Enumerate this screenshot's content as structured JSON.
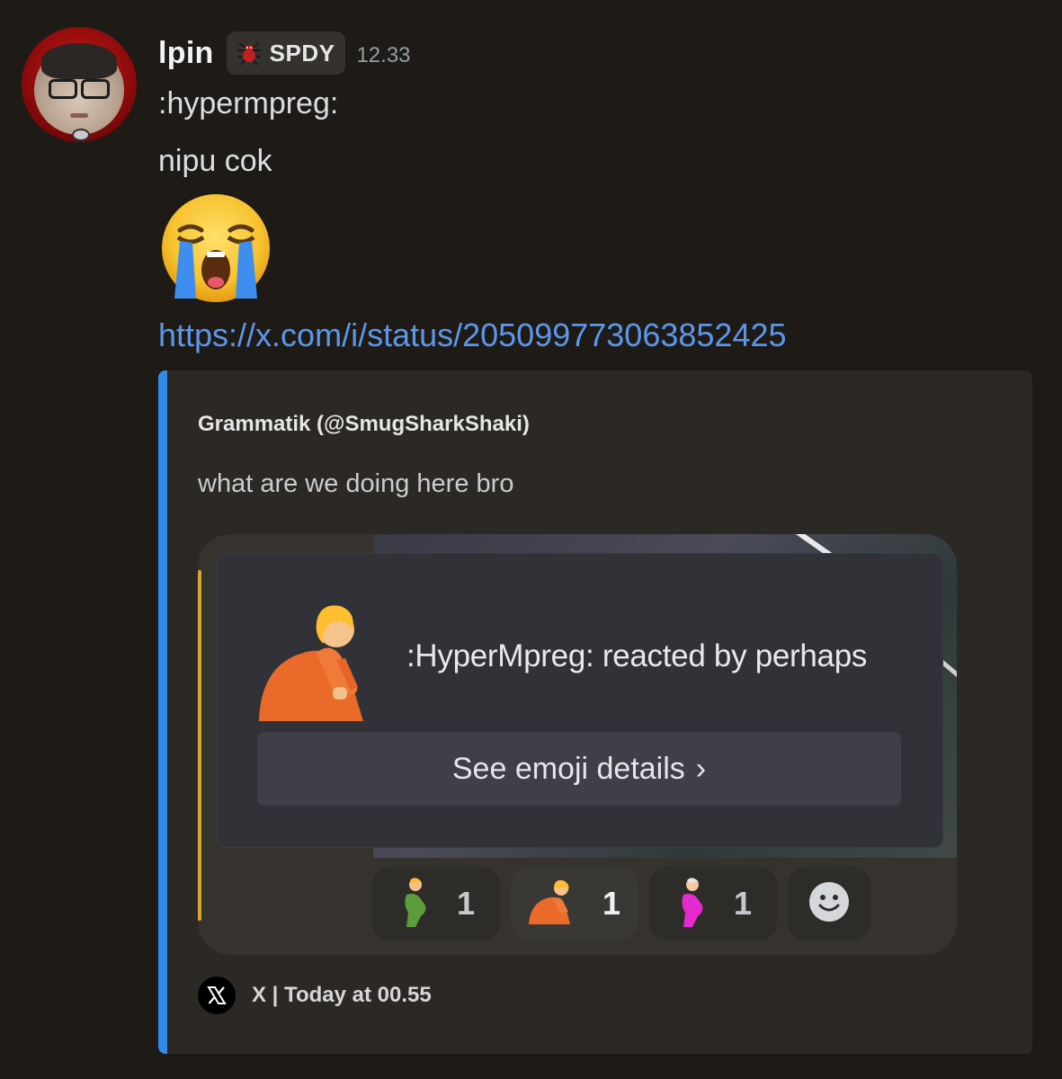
{
  "message": {
    "username": "lpin",
    "tag": "SPDY",
    "timestamp": "12.33",
    "lines": [
      ":hypermpreg:",
      "nipu cok"
    ],
    "big_emoji": "loudly-crying-face",
    "link": "https://x.com/i/status/2050997730638524 25"
  },
  "embed": {
    "accent_color": "#2f8ae8",
    "author": "Grammatik (@SmugSharkShaki)",
    "description": "what are we doing here bro",
    "image": {
      "popup": {
        "title": ":HyperMpreg: reacted by perhaps",
        "button_label": "See emoji details"
      },
      "reactions": [
        {
          "emoji": "pregnant-person-green-icon",
          "count": "1",
          "active": false
        },
        {
          "emoji": "hyper-pregnant-orange-icon",
          "count": "1",
          "active": true
        },
        {
          "emoji": "pregnant-person-pink-icon",
          "count": "1",
          "active": false
        }
      ]
    },
    "footer": {
      "source": "X | Today at 00.55"
    }
  }
}
